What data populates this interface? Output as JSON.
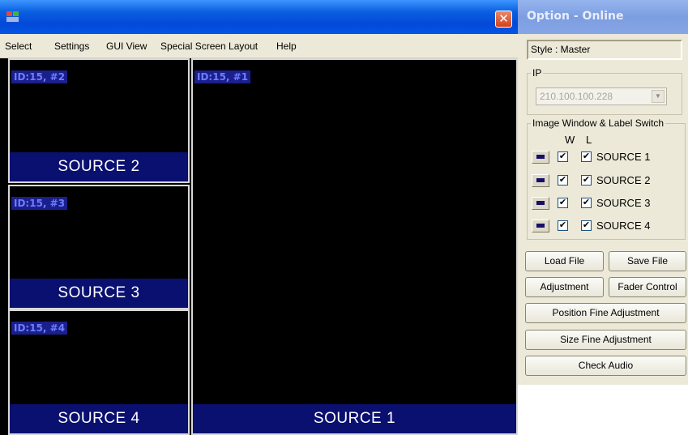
{
  "main_window": {
    "close_glyph": "✕",
    "menu": [
      "Select",
      "Settings",
      "GUI View",
      "Special Screen Layout",
      "Help"
    ],
    "panes": [
      {
        "id_text": "ID:15, #2",
        "label": "SOURCE 2"
      },
      {
        "id_text": "ID:15, #3",
        "label": "SOURCE 3"
      },
      {
        "id_text": "ID:15, #4",
        "label": "SOURCE 4"
      },
      {
        "id_text": "ID:15, #1",
        "label": "SOURCE 1"
      }
    ]
  },
  "option_panel": {
    "title": "Option - Online",
    "style_text": "Style : Master",
    "ip_group_label": "IP",
    "ip_value": "210.100.100.228",
    "switch_group_label": "Image Window & Label Switch",
    "col_w": "W",
    "col_l": "L",
    "rows": [
      {
        "label": "SOURCE 1",
        "w_checked": true,
        "l_checked": true
      },
      {
        "label": "SOURCE 2",
        "w_checked": true,
        "l_checked": true
      },
      {
        "label": "SOURCE 3",
        "w_checked": true,
        "l_checked": true
      },
      {
        "label": "SOURCE 4",
        "w_checked": true,
        "l_checked": true
      }
    ],
    "check_glyph": "✔",
    "buttons": {
      "load_file": "Load File",
      "save_file": "Save File",
      "adjustment": "Adjustment",
      "fader_control": "Fader Control",
      "position_fine": "Position Fine Adjustment",
      "size_fine": "Size Fine Adjustment",
      "check_audio": "Check Audio"
    }
  },
  "colors": {
    "titlebar_blue": "#0349d8",
    "pane_label_bg": "#0a1070",
    "id_tag_bg": "#1b1f8c",
    "panel_bg": "#ece9d8"
  }
}
